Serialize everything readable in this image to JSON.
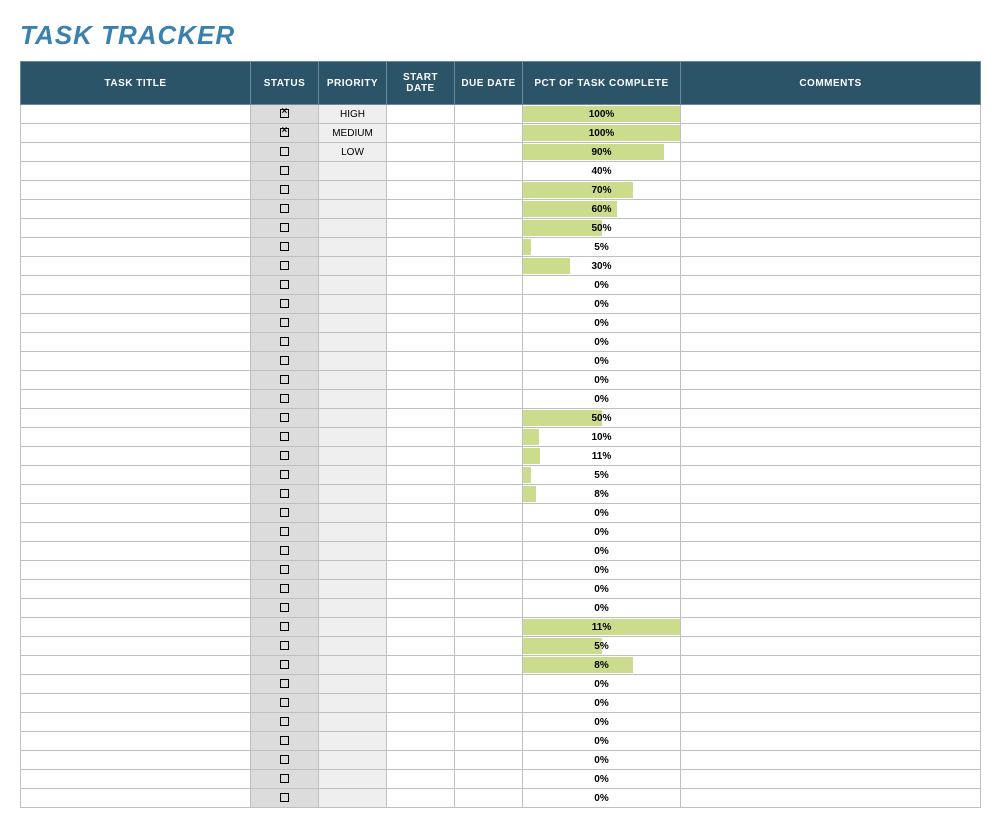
{
  "title": "TASK TRACKER",
  "columns": [
    "TASK TITLE",
    "STATUS",
    "PRIORITY",
    "START DATE",
    "DUE DATE",
    "PCT OF TASK COMPLETE",
    "COMMENTS"
  ],
  "rows": [
    {
      "title": "",
      "checked": true,
      "priority": "HIGH",
      "start": "",
      "due": "",
      "pct": 100,
      "barPct": 100,
      "comments": ""
    },
    {
      "title": "",
      "checked": true,
      "priority": "MEDIUM",
      "start": "",
      "due": "",
      "pct": 100,
      "barPct": 100,
      "comments": ""
    },
    {
      "title": "",
      "checked": false,
      "priority": "LOW",
      "start": "",
      "due": "",
      "pct": 90,
      "barPct": 90,
      "comments": ""
    },
    {
      "title": "",
      "checked": false,
      "priority": "",
      "start": "",
      "due": "",
      "pct": 40,
      "barPct": 0,
      "comments": ""
    },
    {
      "title": "",
      "checked": false,
      "priority": "",
      "start": "",
      "due": "",
      "pct": 70,
      "barPct": 70,
      "comments": ""
    },
    {
      "title": "",
      "checked": false,
      "priority": "",
      "start": "",
      "due": "",
      "pct": 60,
      "barPct": 60,
      "comments": ""
    },
    {
      "title": "",
      "checked": false,
      "priority": "",
      "start": "",
      "due": "",
      "pct": 50,
      "barPct": 50,
      "comments": ""
    },
    {
      "title": "",
      "checked": false,
      "priority": "",
      "start": "",
      "due": "",
      "pct": 5,
      "barPct": 5,
      "comments": ""
    },
    {
      "title": "",
      "checked": false,
      "priority": "",
      "start": "",
      "due": "",
      "pct": 30,
      "barPct": 30,
      "comments": ""
    },
    {
      "title": "",
      "checked": false,
      "priority": "",
      "start": "",
      "due": "",
      "pct": 0,
      "barPct": 0,
      "comments": ""
    },
    {
      "title": "",
      "checked": false,
      "priority": "",
      "start": "",
      "due": "",
      "pct": 0,
      "barPct": 0,
      "comments": ""
    },
    {
      "title": "",
      "checked": false,
      "priority": "",
      "start": "",
      "due": "",
      "pct": 0,
      "barPct": 0,
      "comments": ""
    },
    {
      "title": "",
      "checked": false,
      "priority": "",
      "start": "",
      "due": "",
      "pct": 0,
      "barPct": 0,
      "comments": ""
    },
    {
      "title": "",
      "checked": false,
      "priority": "",
      "start": "",
      "due": "",
      "pct": 0,
      "barPct": 0,
      "comments": ""
    },
    {
      "title": "",
      "checked": false,
      "priority": "",
      "start": "",
      "due": "",
      "pct": 0,
      "barPct": 0,
      "comments": ""
    },
    {
      "title": "",
      "checked": false,
      "priority": "",
      "start": "",
      "due": "",
      "pct": 0,
      "barPct": 0,
      "comments": ""
    },
    {
      "title": "",
      "checked": false,
      "priority": "",
      "start": "",
      "due": "",
      "pct": 50,
      "barPct": 50,
      "comments": ""
    },
    {
      "title": "",
      "checked": false,
      "priority": "",
      "start": "",
      "due": "",
      "pct": 10,
      "barPct": 10,
      "comments": ""
    },
    {
      "title": "",
      "checked": false,
      "priority": "",
      "start": "",
      "due": "",
      "pct": 11,
      "barPct": 11,
      "comments": ""
    },
    {
      "title": "",
      "checked": false,
      "priority": "",
      "start": "",
      "due": "",
      "pct": 5,
      "barPct": 5,
      "comments": ""
    },
    {
      "title": "",
      "checked": false,
      "priority": "",
      "start": "",
      "due": "",
      "pct": 8,
      "barPct": 8,
      "comments": ""
    },
    {
      "title": "",
      "checked": false,
      "priority": "",
      "start": "",
      "due": "",
      "pct": 0,
      "barPct": 0,
      "comments": ""
    },
    {
      "title": "",
      "checked": false,
      "priority": "",
      "start": "",
      "due": "",
      "pct": 0,
      "barPct": 0,
      "comments": ""
    },
    {
      "title": "",
      "checked": false,
      "priority": "",
      "start": "",
      "due": "",
      "pct": 0,
      "barPct": 0,
      "comments": ""
    },
    {
      "title": "",
      "checked": false,
      "priority": "",
      "start": "",
      "due": "",
      "pct": 0,
      "barPct": 0,
      "comments": ""
    },
    {
      "title": "",
      "checked": false,
      "priority": "",
      "start": "",
      "due": "",
      "pct": 0,
      "barPct": 0,
      "comments": ""
    },
    {
      "title": "",
      "checked": false,
      "priority": "",
      "start": "",
      "due": "",
      "pct": 0,
      "barPct": 0,
      "comments": ""
    },
    {
      "title": "",
      "checked": false,
      "priority": "",
      "start": "",
      "due": "",
      "pct": 11,
      "barPct": 100,
      "comments": ""
    },
    {
      "title": "",
      "checked": false,
      "priority": "",
      "start": "",
      "due": "",
      "pct": 5,
      "barPct": 50,
      "comments": ""
    },
    {
      "title": "",
      "checked": false,
      "priority": "",
      "start": "",
      "due": "",
      "pct": 8,
      "barPct": 70,
      "comments": ""
    },
    {
      "title": "",
      "checked": false,
      "priority": "",
      "start": "",
      "due": "",
      "pct": 0,
      "barPct": 0,
      "comments": ""
    },
    {
      "title": "",
      "checked": false,
      "priority": "",
      "start": "",
      "due": "",
      "pct": 0,
      "barPct": 0,
      "comments": ""
    },
    {
      "title": "",
      "checked": false,
      "priority": "",
      "start": "",
      "due": "",
      "pct": 0,
      "barPct": 0,
      "comments": ""
    },
    {
      "title": "",
      "checked": false,
      "priority": "",
      "start": "",
      "due": "",
      "pct": 0,
      "barPct": 0,
      "comments": ""
    },
    {
      "title": "",
      "checked": false,
      "priority": "",
      "start": "",
      "due": "",
      "pct": 0,
      "barPct": 0,
      "comments": ""
    },
    {
      "title": "",
      "checked": false,
      "priority": "",
      "start": "",
      "due": "",
      "pct": 0,
      "barPct": 0,
      "comments": ""
    },
    {
      "title": "",
      "checked": false,
      "priority": "",
      "start": "",
      "due": "",
      "pct": 0,
      "barPct": 0,
      "comments": ""
    }
  ]
}
